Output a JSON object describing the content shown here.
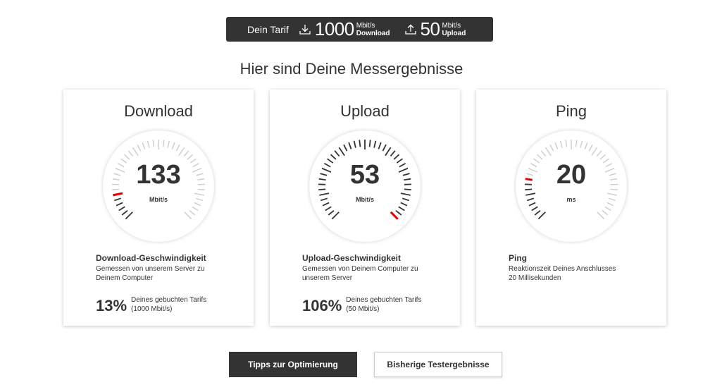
{
  "tarif": {
    "label": "Dein Tarif",
    "download_value": "1000",
    "download_unit_top": "Mbit/s",
    "download_unit_bottom": "Download",
    "upload_value": "50",
    "upload_unit_top": "Mbit/s",
    "upload_unit_bottom": "Upload"
  },
  "headline": "Hier sind Deine Messergebnisse",
  "cards": [
    {
      "title": "Download",
      "value": "133",
      "unit": "Mbit/s",
      "gauge_fraction": 0.133,
      "info_title": "Download-Geschwindigkeit",
      "info_line1": "Gemessen von unserem Server zu",
      "info_line2": "Deinem Computer",
      "percent": "13%",
      "percent_line1": "Deines gebuchten Tarifs",
      "percent_line2": "(1000 Mbit/s)"
    },
    {
      "title": "Upload",
      "value": "53",
      "unit": "Mbit/s",
      "gauge_fraction": 1.06,
      "info_title": "Upload-Geschwindigkeit",
      "info_line1": "Gemessen von Deinem Computer zu",
      "info_line2": "unserem Server",
      "percent": "106%",
      "percent_line1": "Deines gebuchten Tarifs",
      "percent_line2": "(50 Mbit/s)"
    },
    {
      "title": "Ping",
      "value": "20",
      "unit": "ms",
      "gauge_fraction": 0.2,
      "info_title": "Ping",
      "info_line1": "Reaktionszeit Deines Anschlusses",
      "info_line2": "20 Millisekunden"
    }
  ],
  "buttons": {
    "tips": "Tipps zur Optimierung",
    "history": "Bisherige Testergebnisse"
  },
  "colors": {
    "accent": "#e60000",
    "dark": "#333333",
    "tick_active": "#333333",
    "tick_inactive": "#cccccc"
  }
}
